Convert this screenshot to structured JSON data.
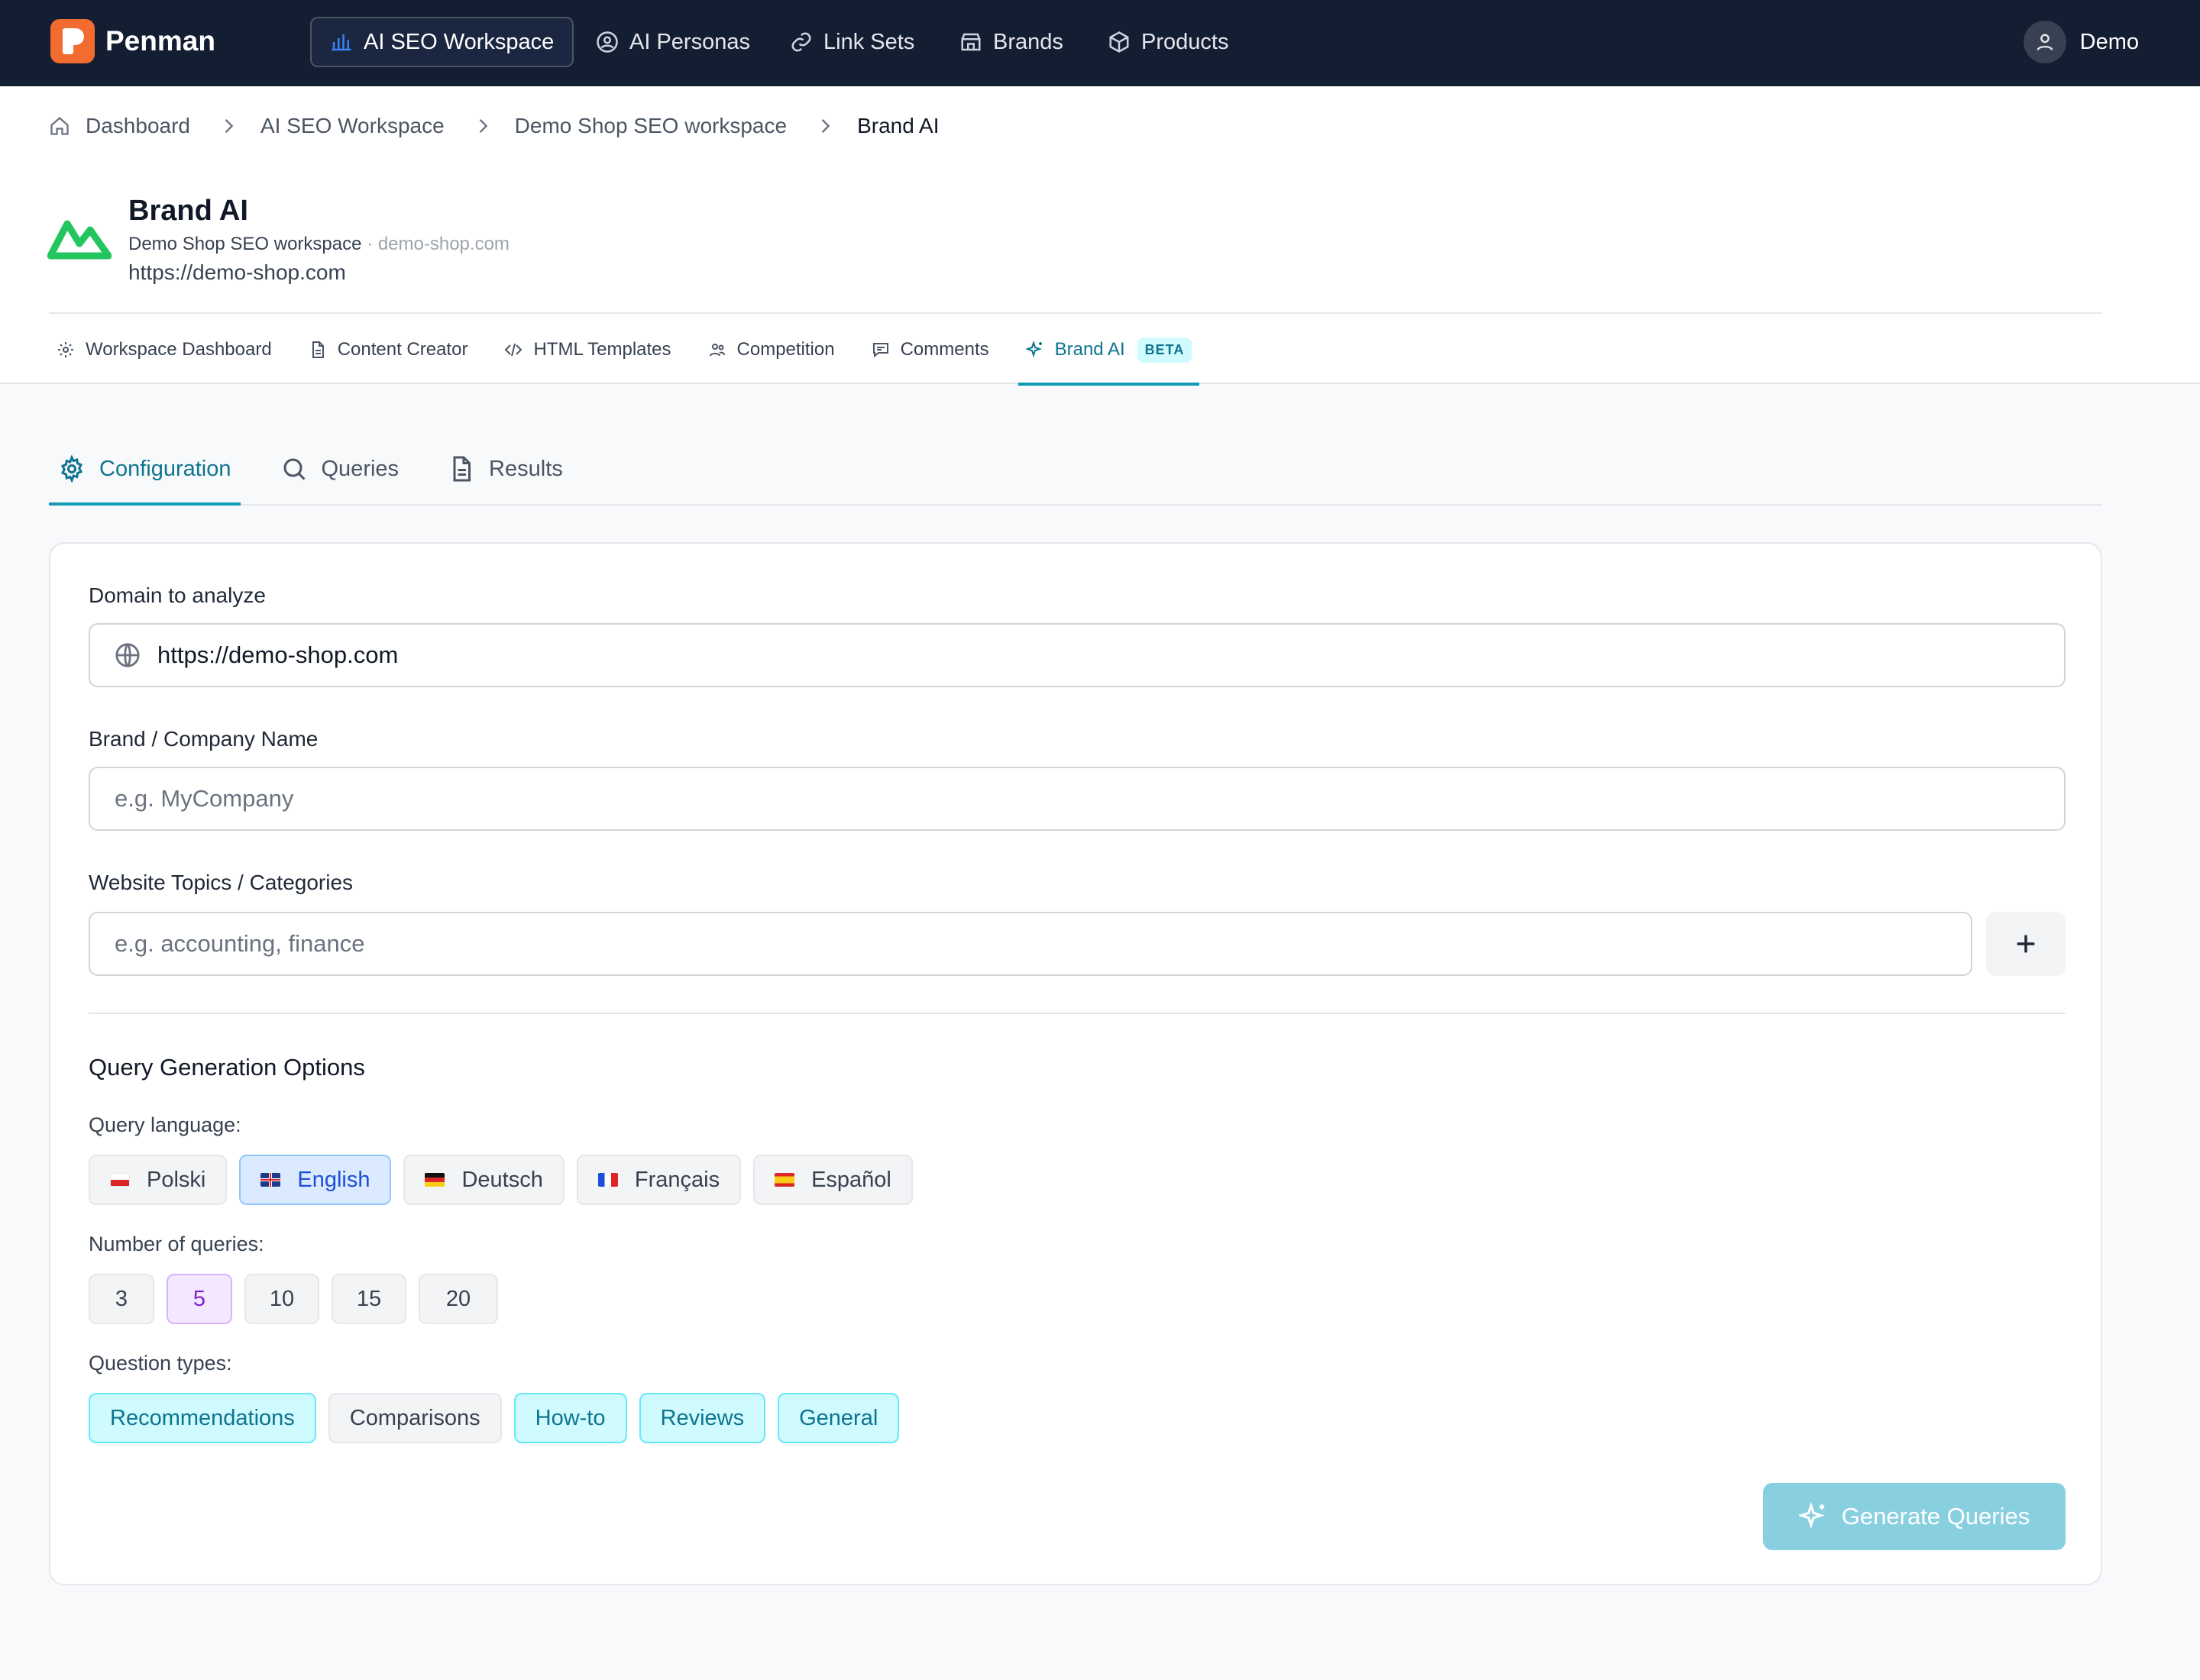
{
  "topnav": {
    "logo_text": "Penman",
    "items": [
      {
        "label": "AI SEO Workspace",
        "icon": "bar-chart-icon",
        "active": true
      },
      {
        "label": "AI Personas",
        "icon": "user-circle-icon"
      },
      {
        "label": "Link Sets",
        "icon": "link-icon"
      },
      {
        "label": "Brands",
        "icon": "store-icon"
      },
      {
        "label": "Products",
        "icon": "box-icon"
      }
    ],
    "user_name": "Demo"
  },
  "breadcrumb": [
    "Dashboard",
    "AI SEO Workspace",
    "Demo Shop SEO workspace",
    "Brand AI"
  ],
  "brand": {
    "title": "Brand AI",
    "workspace": "Demo Shop SEO workspace",
    "separator": "·",
    "domain": "demo-shop.com",
    "url": "https://demo-shop.com",
    "logo_color": "#22c55e"
  },
  "subtabs": [
    {
      "label": "Workspace Dashboard",
      "icon": "gear-icon"
    },
    {
      "label": "Content Creator",
      "icon": "document-icon"
    },
    {
      "label": "HTML Templates",
      "icon": "code-icon"
    },
    {
      "label": "Competition",
      "icon": "users-icon"
    },
    {
      "label": "Comments",
      "icon": "comment-icon"
    },
    {
      "label": "Brand AI",
      "icon": "sparkles-icon",
      "active": true,
      "badge": "BETA"
    }
  ],
  "page_tabs": [
    {
      "label": "Configuration",
      "icon": "gear-icon",
      "active": true
    },
    {
      "label": "Queries",
      "icon": "search-icon"
    },
    {
      "label": "Results",
      "icon": "document-icon"
    }
  ],
  "form": {
    "domain_label": "Domain to analyze",
    "domain_value": "https://demo-shop.com",
    "brand_label": "Brand / Company Name",
    "brand_placeholder": "e.g. MyCompany",
    "topics_label": "Website Topics / Categories",
    "topics_placeholder": "e.g. accounting, finance",
    "options_title": "Query Generation Options",
    "language_label": "Query language:",
    "languages": [
      {
        "label": "Polski",
        "flag": "pl"
      },
      {
        "label": "English",
        "flag": "gb",
        "selected": true
      },
      {
        "label": "Deutsch",
        "flag": "de"
      },
      {
        "label": "Français",
        "flag": "fr"
      },
      {
        "label": "Español",
        "flag": "es"
      }
    ],
    "count_label": "Number of queries:",
    "counts": [
      "3",
      "5",
      "10",
      "15",
      "20"
    ],
    "selected_count": "5",
    "types_label": "Question types:",
    "types": [
      {
        "label": "Recommendations",
        "selected": true
      },
      {
        "label": "Comparisons",
        "selected": false
      },
      {
        "label": "How-to",
        "selected": true
      },
      {
        "label": "Reviews",
        "selected": true
      },
      {
        "label": "General",
        "selected": true
      }
    ],
    "generate_label": "Generate Queries"
  },
  "colors": {
    "nav_bg": "#141e33",
    "accent": "#0e9bb3",
    "logo": "#f26b2f"
  }
}
